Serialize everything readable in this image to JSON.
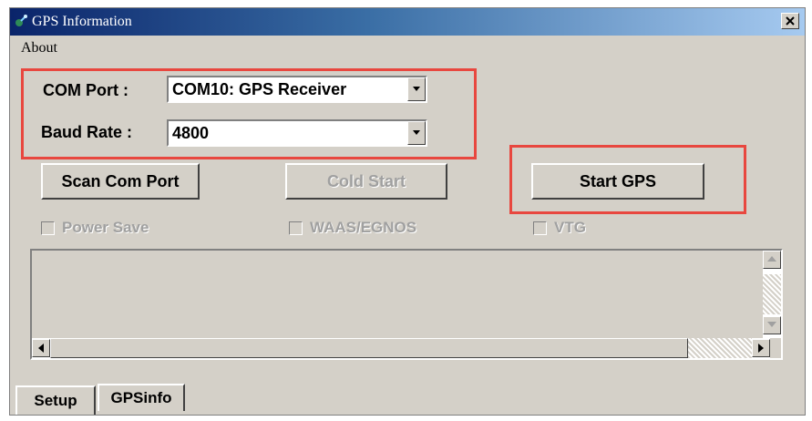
{
  "window": {
    "title": "GPS Information",
    "icon": "satellite-dish-icon",
    "close_icon": "close-icon"
  },
  "menu": {
    "about": "About"
  },
  "setup": {
    "com_port_label": "COM Port :",
    "com_port_value": "COM10:  GPS Receiver",
    "baud_rate_label": "Baud Rate :",
    "baud_rate_value": "4800",
    "scan_button": "Scan Com Port",
    "cold_start_button": "Cold Start",
    "start_gps_button": "Start GPS",
    "power_save_label": "Power Save",
    "waas_label": "WAAS/EGNOS",
    "vtg_label": "VTG",
    "power_save_checked": false,
    "waas_checked": false,
    "vtg_checked": false
  },
  "tabs": [
    {
      "label": "Setup",
      "active": true
    },
    {
      "label": "GPSinfo",
      "active": false
    }
  ],
  "colors": {
    "highlight": "#e8473f",
    "face": "#d4d0c8",
    "title_start": "#0a246a",
    "title_end": "#a6caf0"
  }
}
